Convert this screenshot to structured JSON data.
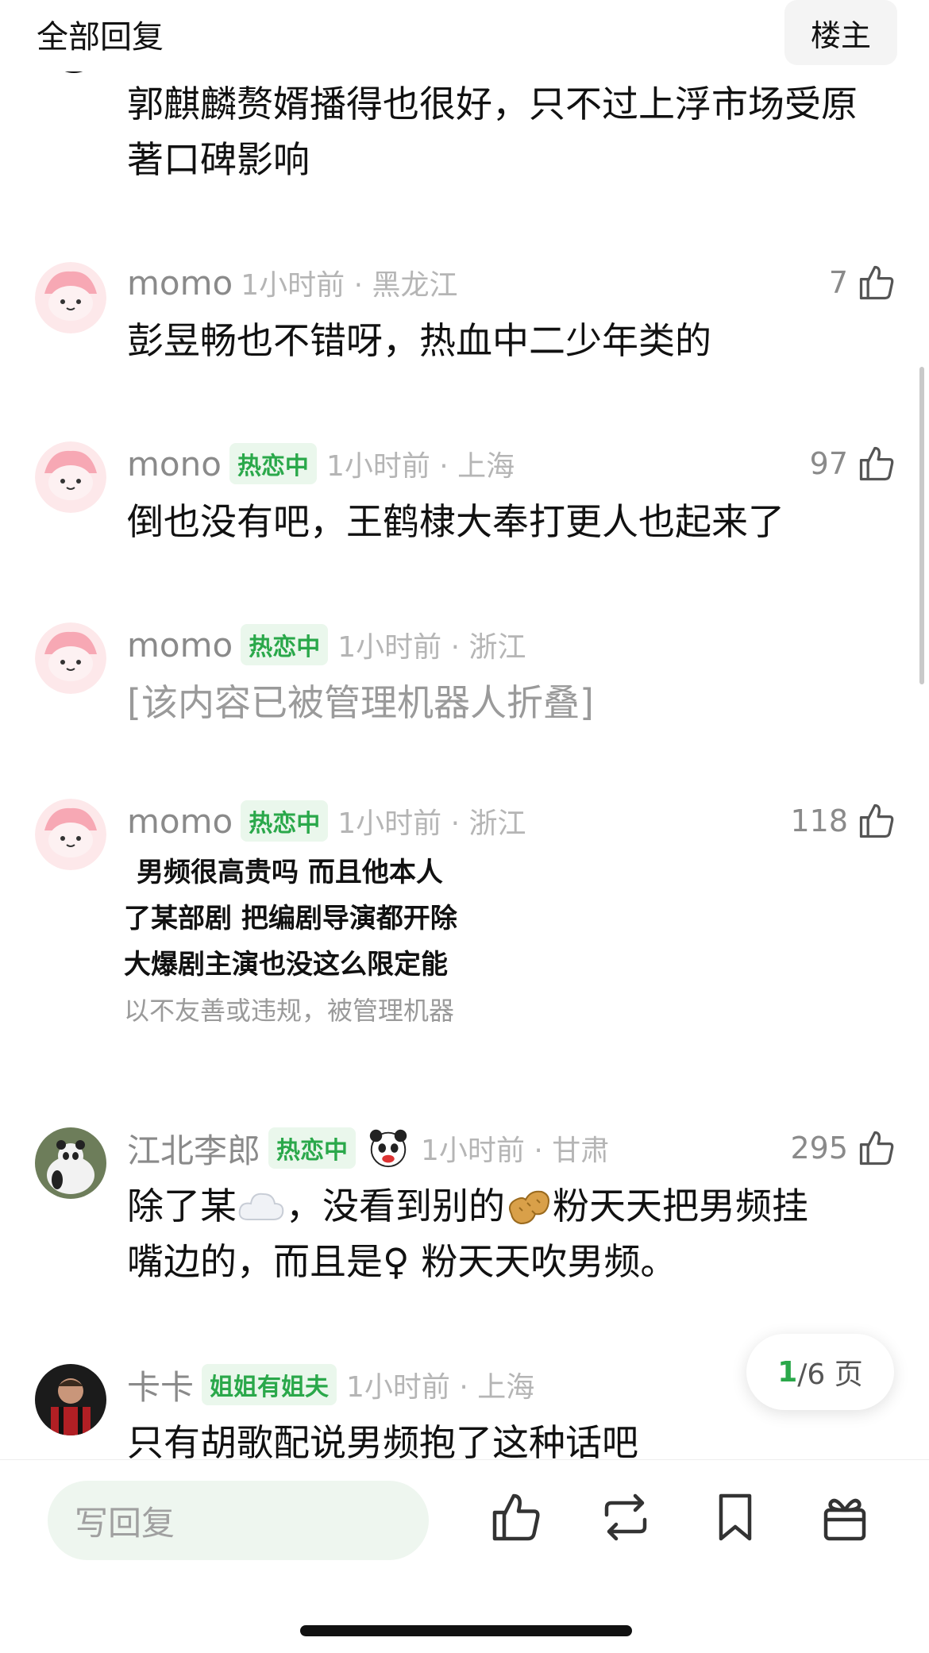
{
  "header": {
    "title": "全部回复",
    "owner_button": "楼主"
  },
  "top_comment": {
    "text": "郭麒麟赘婿播得也很好，只不过上浮市场受原著口碑影响"
  },
  "comments": [
    {
      "name": "momo",
      "tag": "",
      "time": "1小时前 · 黑龙江",
      "likes": "7",
      "text": "彭昱畅也不错呀，热血中二少年类的"
    },
    {
      "name": "mono",
      "tag": "热恋中",
      "time": "1小时前 · 上海",
      "likes": "97",
      "text": "倒也没有吧，王鹤棣大奉打更人也起来了"
    },
    {
      "name": "momo",
      "tag": "热恋中",
      "time": "1小时前 · 浙江",
      "likes": "",
      "text": "[该内容已被管理机器人折叠]"
    },
    {
      "name": "momo",
      "tag": "热恋中",
      "time": "1小时前 · 浙江",
      "likes": "118",
      "image_lines": [
        "男频很高贵吗 而且他本人",
        "了某部剧 把编剧导演都开除",
        "大爆剧主演也没这么限定能",
        "以不友善或违规，被管理机器"
      ]
    },
    {
      "name": "江北李郎",
      "tag": "热恋中",
      "time": "1小时前 · 甘肃",
      "likes": "295",
      "text_line1_a": "除了某",
      "text_line1_b": "，没看到别的",
      "text_line1_c": "粉天天把男频挂",
      "text_line2": "嘴边的，而且是♀ 粉天天吹男频。"
    },
    {
      "name": "卡卡",
      "tag": "姐姐有姐夫",
      "time": "1小时前 · 上海",
      "likes": "",
      "text": "只有胡歌配说男频抱了这种话吧"
    }
  ],
  "pagination": {
    "current": "1",
    "total_text": "/6 页"
  },
  "bottom_bar": {
    "reply_placeholder": "写回复"
  },
  "colors": {
    "accent": "#2aa84a",
    "tag_bg": "#eaf7ec"
  },
  "icons": [
    "thumb-up-icon",
    "repost-icon",
    "bookmark-icon",
    "gift-icon",
    "cloud-emoji-icon",
    "peanut-emoji-icon",
    "panda-badge-icon"
  ]
}
